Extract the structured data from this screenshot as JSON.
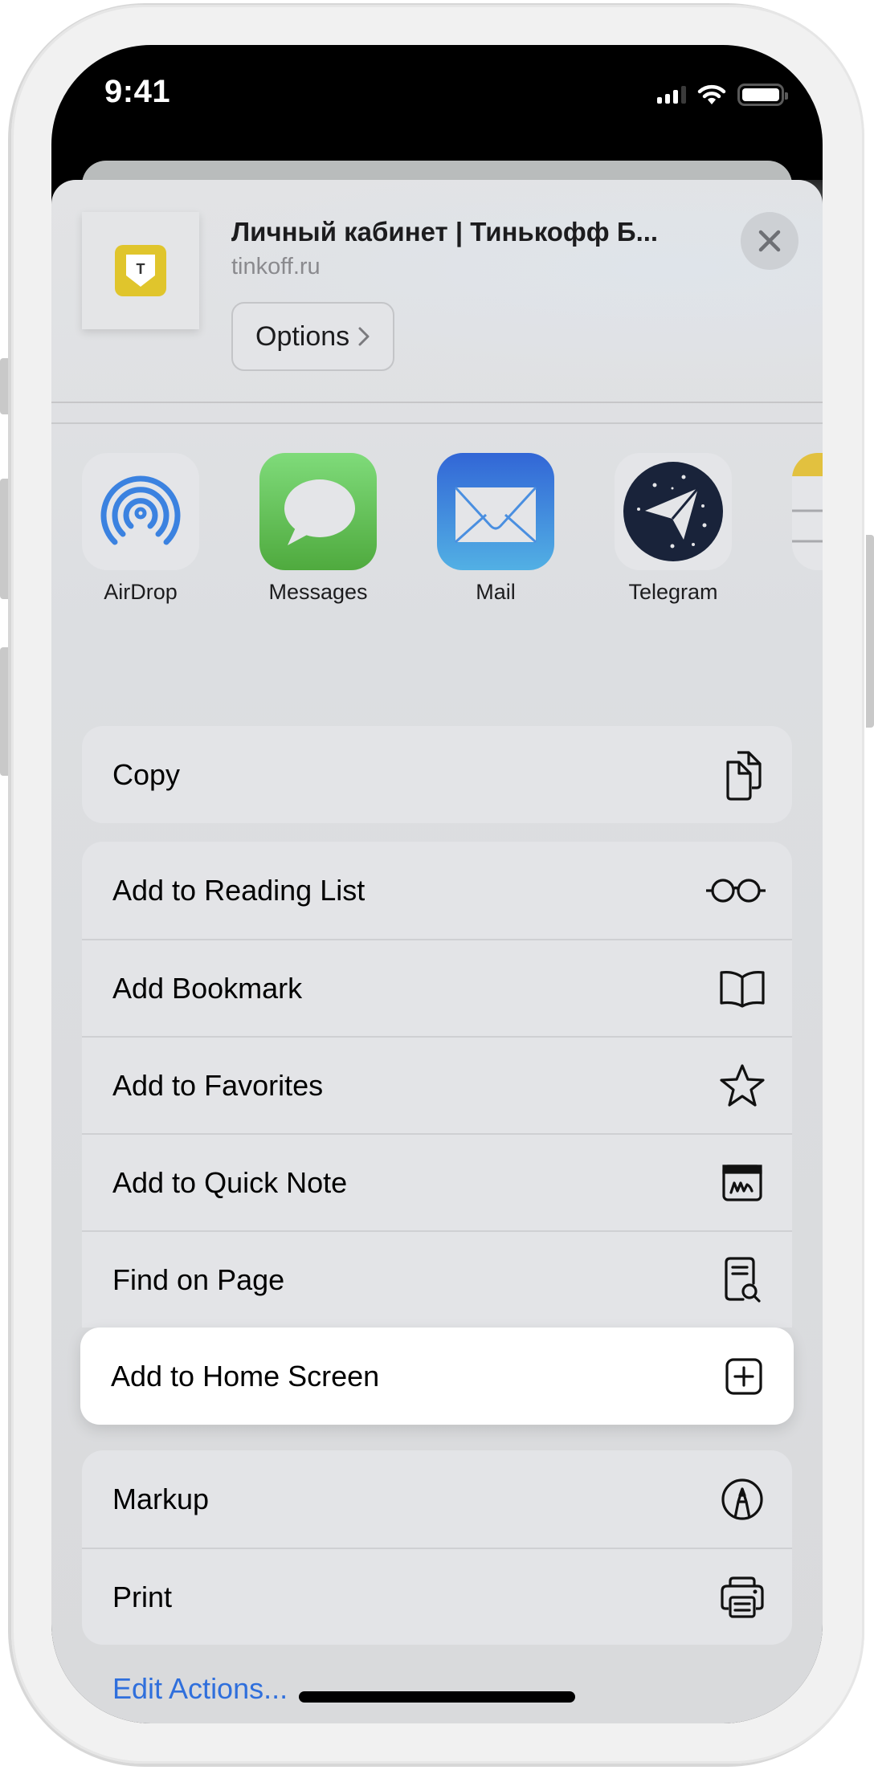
{
  "status_bar": {
    "time": "9:41",
    "icons": [
      "cellular-signal-icon",
      "wifi-icon",
      "battery-icon"
    ],
    "battery_level_percent": 100,
    "signal_bars_active": 3,
    "signal_bars_total": 4
  },
  "share_header": {
    "page_title": "Личный кабинет | Тинькофф Б...",
    "page_url": "tinkoff.ru",
    "options_label": "Options",
    "options_icon": "chevron-right-icon",
    "close_icon": "close-icon",
    "thumbnail_icon": "tinkoff-logo-icon",
    "thumbnail_letter": "Т"
  },
  "apps": [
    {
      "label": "AirDrop",
      "icon": "airdrop-icon"
    },
    {
      "label": "Messages",
      "icon": "messages-icon"
    },
    {
      "label": "Mail",
      "icon": "mail-icon"
    },
    {
      "label": "Telegram",
      "icon": "telegram-icon"
    },
    {
      "label": "",
      "icon": "notes-icon"
    }
  ],
  "action_groups": [
    [
      {
        "label": "Copy",
        "icon": "copy-icon"
      }
    ],
    [
      {
        "label": "Add to Reading List",
        "icon": "glasses-icon"
      },
      {
        "label": "Add Bookmark",
        "icon": "book-icon"
      },
      {
        "label": "Add to Favorites",
        "icon": "star-icon"
      },
      {
        "label": "Add to Quick Note",
        "icon": "quick-note-icon"
      },
      {
        "label": "Find on Page",
        "icon": "find-on-page-icon"
      },
      {
        "label": "Add to Home Screen",
        "icon": "plus-square-icon",
        "highlighted": true
      }
    ],
    [
      {
        "label": "Markup",
        "icon": "markup-icon"
      },
      {
        "label": "Print",
        "icon": "printer-icon"
      }
    ]
  ],
  "edit_actions_label": "Edit Actions...",
  "colors": {
    "accent": "#2f6fdc",
    "tinkoff_yellow": "#e0c52c",
    "messages_green": "#5cc35a",
    "mail_blue": "#3d84e0",
    "telegram_dark": "#19233a",
    "airdrop_blue": "#3b82e0"
  }
}
